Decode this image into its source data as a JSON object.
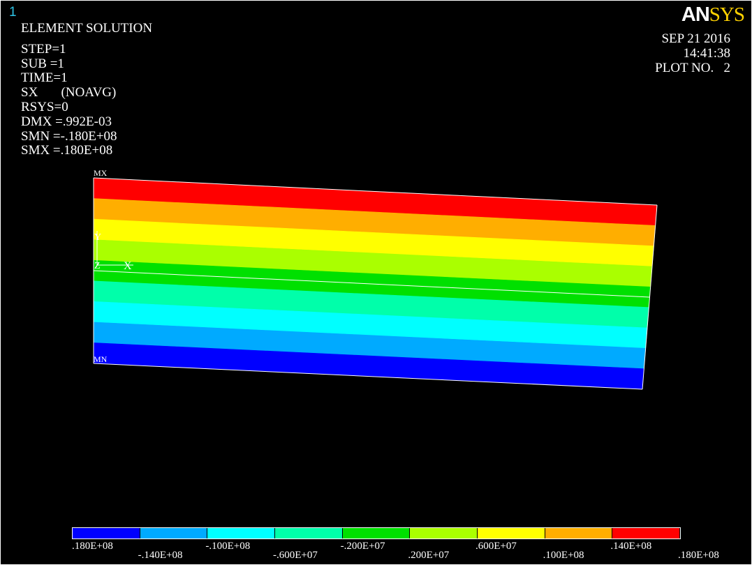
{
  "window_number": "1",
  "logo": {
    "part1": "AN",
    "part2": "SYS"
  },
  "info_lines": [
    "ELEMENT SOLUTION",
    "",
    "STEP=1",
    "SUB =1",
    "TIME=1",
    "SX       (NOAVG)",
    "RSYS=0",
    "DMX =.992E-03",
    "SMN =-.180E+08",
    "SMX =.180E+08"
  ],
  "datetime": {
    "date": "SEP 21 2016",
    "time": "14:41:38",
    "plot": "PLOT NO.   2"
  },
  "markers": {
    "max": "MX",
    "min": "MN",
    "axis_x": "X",
    "axis_y": "Y",
    "axis_z": "Z"
  },
  "contour_colors": [
    "#ff0000",
    "#ffae00",
    "#ffff00",
    "#aaff00",
    "#00e000",
    "#00ffaa",
    "#00ffff",
    "#00aaff",
    "#0000ff"
  ],
  "legend": {
    "colors": [
      "#0000ff",
      "#00aaff",
      "#00ffff",
      "#00ffaa",
      "#00e000",
      "#aaff00",
      "#ffff00",
      "#ffae00",
      "#ff0000"
    ],
    "labels": [
      ".180E+08",
      "-.140E+08",
      "-.100E+08",
      "-.600E+07",
      "-.200E+07",
      ".200E+07",
      ".600E+07",
      ".100E+08",
      ".140E+08",
      ".180E+08"
    ]
  }
}
